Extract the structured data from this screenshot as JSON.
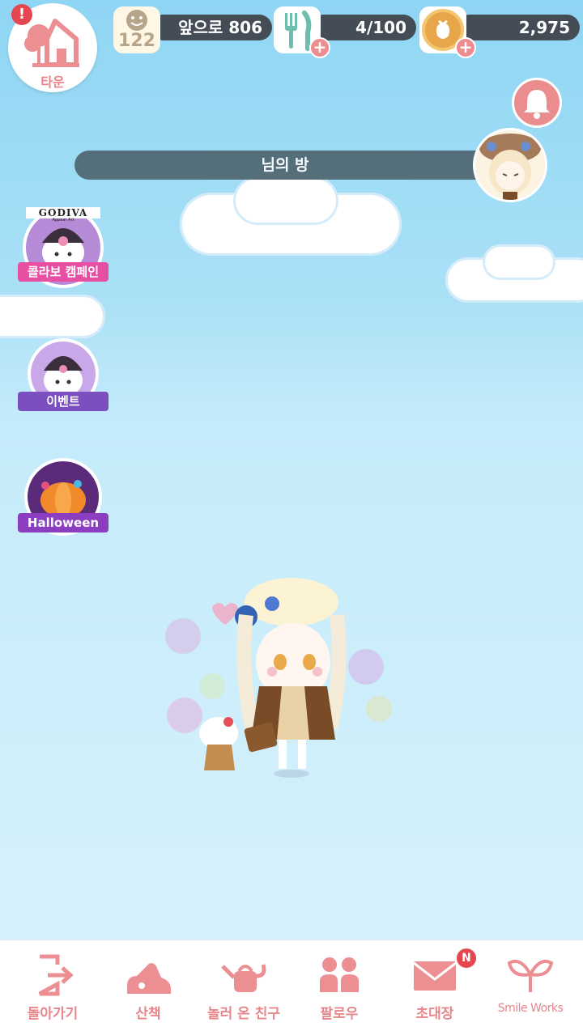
{
  "town": {
    "label": "타운",
    "alert": "!"
  },
  "stats": {
    "level": {
      "number": "122",
      "value": "앞으로 806"
    },
    "food": {
      "value": "4/100"
    },
    "coins": {
      "value": "2,975"
    }
  },
  "room": {
    "title": "님의 방"
  },
  "banners": [
    {
      "brand": "GODIVA",
      "sub": "Appear Art",
      "label": "콜라보 캠페인"
    },
    {
      "label": "이벤트"
    },
    {
      "label": "Halloween"
    }
  ],
  "tabs": [
    {
      "label": "돌아가기",
      "icon": "exit-door-icon"
    },
    {
      "label": "산책",
      "icon": "shoe-icon"
    },
    {
      "label": "놀러 온 친구",
      "icon": "watering-can-icon"
    },
    {
      "label": "팔로우",
      "icon": "people-icon"
    },
    {
      "label": "초대장",
      "icon": "envelope-icon",
      "badge": "N"
    },
    {
      "label": "Smile Works",
      "icon": "sprout-icon"
    }
  ],
  "colors": {
    "accent": "#e6868b",
    "alert": "#e4474f",
    "bar": "#444d56",
    "sky": "#a9e0f6"
  }
}
